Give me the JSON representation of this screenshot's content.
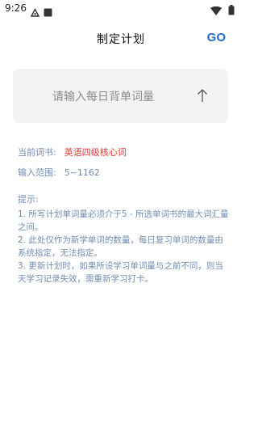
{
  "status_bar": {
    "time": "9:26"
  },
  "header": {
    "title": "制定计划",
    "go_label": "GO"
  },
  "input": {
    "placeholder": "请输入每日背单词量"
  },
  "info": {
    "book_label": "当前词书:",
    "book_value": "英语四级核心词",
    "range_label": "输入范围:",
    "range_value": "5~1162"
  },
  "tips": {
    "title": "提示:",
    "items": [
      "1. 所写计划单词量必须介于5 - 所选单词书的最大词汇量之间。",
      "2. 此处仅作为新学单词的数量，每日复习单词的数量由系统指定，无法指定。",
      "3. 更新计划时，如果所设学习单词量与之前不同，则当天学习记录失效，需重新学习打卡。"
    ]
  },
  "colors": {
    "accent_blue": "#1f6bd1",
    "label_blue": "#6f8db3",
    "highlight_red": "#e53935",
    "card_bg": "#f3f3f5"
  },
  "icons": {
    "notification": "notification-icon",
    "app_square": "app-square-icon",
    "wifi": "wifi-icon",
    "battery": "battery-icon",
    "arrow_up": "arrow-up-icon"
  }
}
